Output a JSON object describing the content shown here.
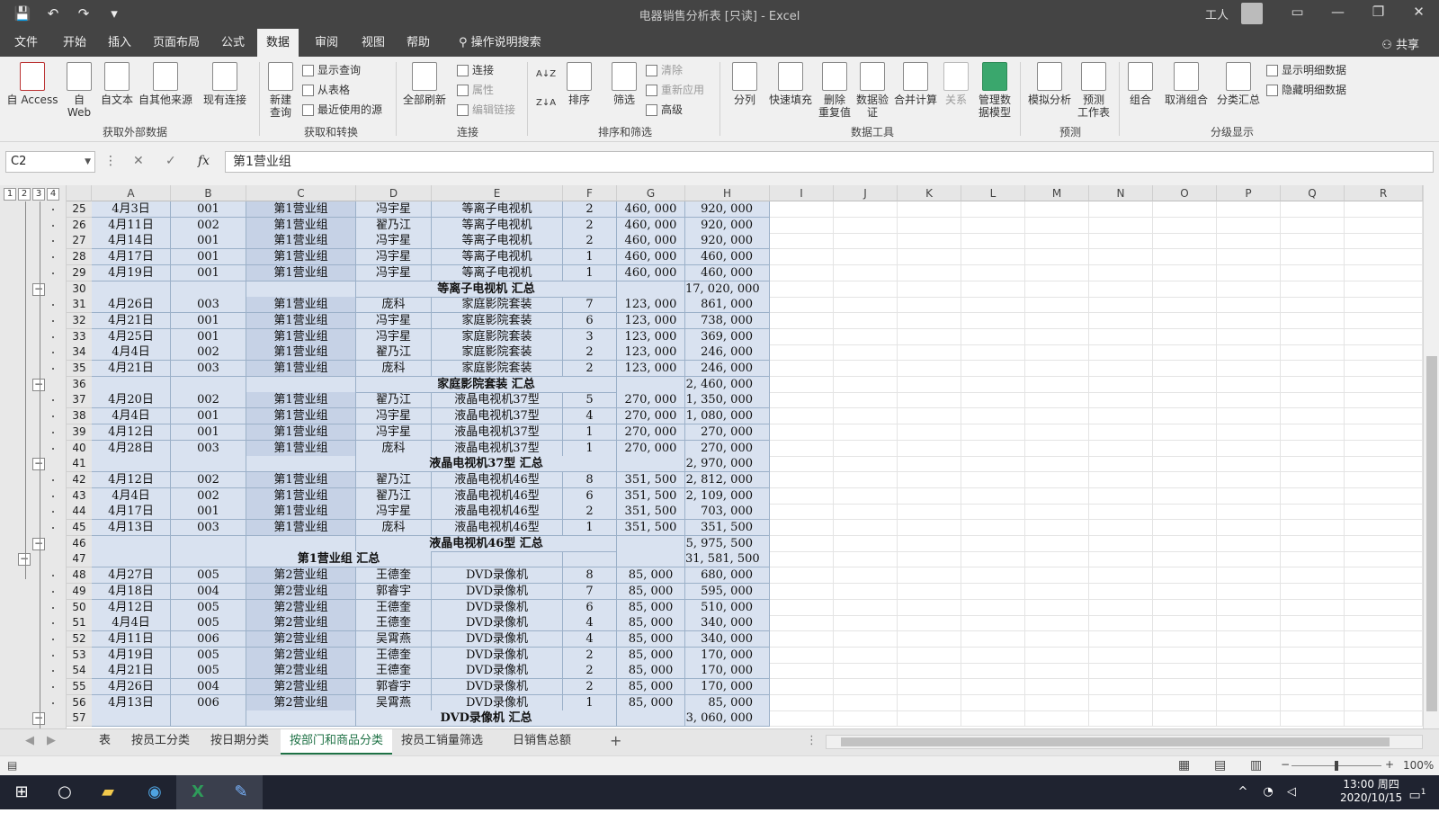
{
  "titlebar": {
    "title": "电器销售分析表  [只读]  -  Excel",
    "user": "工人",
    "qat_save": "💾",
    "qat_undo": "↶",
    "qat_redo": "↷",
    "qat_more": "▾",
    "win_ribbon": "▭",
    "win_min": "—",
    "win_max": "❐",
    "win_close": "✕"
  },
  "menu": {
    "tabs": [
      "文件",
      "开始",
      "插入",
      "页面布局",
      "公式",
      "数据",
      "审阅",
      "视图",
      "帮助",
      "操作说明搜索"
    ],
    "active": "数据",
    "share": "共享"
  },
  "ribbon": {
    "groups": [
      "获取外部数据",
      "获取和转换",
      "连接",
      "排序和筛选",
      "数据工具",
      "预测",
      "分级显示"
    ],
    "ext": [
      "自 Access",
      "自\nWeb",
      "自文本",
      "自其他来源",
      "现有连接"
    ],
    "gt_big": "新建\n查询",
    "gt_small": [
      "显示查询",
      "从表格",
      "最近使用的源"
    ],
    "conn_big": "全部刷新",
    "conn_small": [
      "连接",
      "属性",
      "编辑链接"
    ],
    "sort_small_az": "A↓Z",
    "sort_small_za": "Z↓A",
    "sort": "排序",
    "filter": "筛选",
    "filter_small": [
      "清除",
      "重新应用",
      "高级"
    ],
    "tools": [
      "分列",
      "快速填充",
      "删除\n重复值",
      "数据验\n证",
      "合并计算",
      "关系",
      "管理数\n据模型"
    ],
    "forecast": [
      "模拟分析",
      "预测\n工作表"
    ],
    "outline": [
      "组合",
      "取消组合",
      "分类汇总"
    ],
    "outline_small": [
      "显示明细数据",
      "隐藏明细数据"
    ]
  },
  "formula": {
    "namebox": "C2",
    "value": "第1营业组",
    "cancel_glyph": "✕",
    "enter_glyph": "✓",
    "fx_glyph": "fx"
  },
  "grid": {
    "levels": [
      "1",
      "2",
      "3",
      "4"
    ],
    "columns": [
      "A",
      "B",
      "C",
      "D",
      "E",
      "F",
      "G",
      "H",
      "I",
      "J",
      "K",
      "L",
      "M",
      "N",
      "O",
      "P",
      "Q",
      "R"
    ],
    "rows": [
      {
        "n": "25",
        "a": "4月3日",
        "b": "001",
        "c": "第1营业组",
        "d": "冯宇星",
        "e": "等离子电视机",
        "f": "2",
        "g": "460, 000",
        "h": "920, 000"
      },
      {
        "n": "26",
        "a": "4月11日",
        "b": "002",
        "c": "第1营业组",
        "d": "翟乃江",
        "e": "等离子电视机",
        "f": "2",
        "g": "460, 000",
        "h": "920, 000"
      },
      {
        "n": "27",
        "a": "4月14日",
        "b": "001",
        "c": "第1营业组",
        "d": "冯宇星",
        "e": "等离子电视机",
        "f": "2",
        "g": "460, 000",
        "h": "920, 000"
      },
      {
        "n": "28",
        "a": "4月17日",
        "b": "001",
        "c": "第1营业组",
        "d": "冯宇星",
        "e": "等离子电视机",
        "f": "1",
        "g": "460, 000",
        "h": "460, 000"
      },
      {
        "n": "29",
        "a": "4月19日",
        "b": "001",
        "c": "第1营业组",
        "d": "冯宇星",
        "e": "等离子电视机",
        "f": "1",
        "g": "460, 000",
        "h": "460, 000"
      },
      {
        "n": "30",
        "sub": "等离子电视机  汇总",
        "h": "17, 020, 000"
      },
      {
        "n": "31",
        "a": "4月26日",
        "b": "003",
        "c": "第1营业组",
        "d": "庞科",
        "e": "家庭影院套装",
        "f": "7",
        "g": "123, 000",
        "h": "861, 000"
      },
      {
        "n": "32",
        "a": "4月21日",
        "b": "001",
        "c": "第1营业组",
        "d": "冯宇星",
        "e": "家庭影院套装",
        "f": "6",
        "g": "123, 000",
        "h": "738, 000"
      },
      {
        "n": "33",
        "a": "4月25日",
        "b": "001",
        "c": "第1营业组",
        "d": "冯宇星",
        "e": "家庭影院套装",
        "f": "3",
        "g": "123, 000",
        "h": "369, 000"
      },
      {
        "n": "34",
        "a": "4月4日",
        "b": "002",
        "c": "第1营业组",
        "d": "翟乃江",
        "e": "家庭影院套装",
        "f": "2",
        "g": "123, 000",
        "h": "246, 000"
      },
      {
        "n": "35",
        "a": "4月21日",
        "b": "003",
        "c": "第1营业组",
        "d": "庞科",
        "e": "家庭影院套装",
        "f": "2",
        "g": "123, 000",
        "h": "246, 000"
      },
      {
        "n": "36",
        "sub": "家庭影院套装  汇总",
        "h": "2, 460, 000"
      },
      {
        "n": "37",
        "a": "4月20日",
        "b": "002",
        "c": "第1营业组",
        "d": "翟乃江",
        "e": "液晶电视机37型",
        "f": "5",
        "g": "270, 000",
        "h": "1, 350, 000"
      },
      {
        "n": "38",
        "a": "4月4日",
        "b": "001",
        "c": "第1营业组",
        "d": "冯宇星",
        "e": "液晶电视机37型",
        "f": "4",
        "g": "270, 000",
        "h": "1, 080, 000"
      },
      {
        "n": "39",
        "a": "4月12日",
        "b": "001",
        "c": "第1营业组",
        "d": "冯宇星",
        "e": "液晶电视机37型",
        "f": "1",
        "g": "270, 000",
        "h": "270, 000"
      },
      {
        "n": "40",
        "a": "4月28日",
        "b": "003",
        "c": "第1营业组",
        "d": "庞科",
        "e": "液晶电视机37型",
        "f": "1",
        "g": "270, 000",
        "h": "270, 000"
      },
      {
        "n": "41",
        "sub": "液晶电视机37型  汇总",
        "h": "2, 970, 000"
      },
      {
        "n": "42",
        "a": "4月12日",
        "b": "002",
        "c": "第1营业组",
        "d": "翟乃江",
        "e": "液晶电视机46型",
        "f": "8",
        "g": "351, 500",
        "h": "2, 812, 000"
      },
      {
        "n": "43",
        "a": "4月4日",
        "b": "002",
        "c": "第1营业组",
        "d": "翟乃江",
        "e": "液晶电视机46型",
        "f": "6",
        "g": "351, 500",
        "h": "2, 109, 000"
      },
      {
        "n": "44",
        "a": "4月17日",
        "b": "001",
        "c": "第1营业组",
        "d": "冯宇星",
        "e": "液晶电视机46型",
        "f": "2",
        "g": "351, 500",
        "h": "703, 000"
      },
      {
        "n": "45",
        "a": "4月13日",
        "b": "003",
        "c": "第1营业组",
        "d": "庞科",
        "e": "液晶电视机46型",
        "f": "1",
        "g": "351, 500",
        "h": "351, 500"
      },
      {
        "n": "46",
        "sub": "液晶电视机46型  汇总",
        "h": "5, 975, 500"
      },
      {
        "n": "47",
        "grp": "第1营业组  汇总",
        "h": "31, 581, 500"
      },
      {
        "n": "48",
        "a": "4月27日",
        "b": "005",
        "c": "第2营业组",
        "d": "王德奎",
        "e": "DVD录像机",
        "f": "8",
        "g": "85, 000",
        "h": "680, 000"
      },
      {
        "n": "49",
        "a": "4月18日",
        "b": "004",
        "c": "第2营业组",
        "d": "郭睿宇",
        "e": "DVD录像机",
        "f": "7",
        "g": "85, 000",
        "h": "595, 000"
      },
      {
        "n": "50",
        "a": "4月12日",
        "b": "005",
        "c": "第2营业组",
        "d": "王德奎",
        "e": "DVD录像机",
        "f": "6",
        "g": "85, 000",
        "h": "510, 000"
      },
      {
        "n": "51",
        "a": "4月4日",
        "b": "005",
        "c": "第2营业组",
        "d": "王德奎",
        "e": "DVD录像机",
        "f": "4",
        "g": "85, 000",
        "h": "340, 000"
      },
      {
        "n": "52",
        "a": "4月11日",
        "b": "006",
        "c": "第2营业组",
        "d": "吴霄燕",
        "e": "DVD录像机",
        "f": "4",
        "g": "85, 000",
        "h": "340, 000"
      },
      {
        "n": "53",
        "a": "4月19日",
        "b": "005",
        "c": "第2营业组",
        "d": "王德奎",
        "e": "DVD录像机",
        "f": "2",
        "g": "85, 000",
        "h": "170, 000"
      },
      {
        "n": "54",
        "a": "4月21日",
        "b": "005",
        "c": "第2营业组",
        "d": "王德奎",
        "e": "DVD录像机",
        "f": "2",
        "g": "85, 000",
        "h": "170, 000"
      },
      {
        "n": "55",
        "a": "4月26日",
        "b": "004",
        "c": "第2营业组",
        "d": "郭睿宇",
        "e": "DVD录像机",
        "f": "2",
        "g": "85, 000",
        "h": "170, 000"
      },
      {
        "n": "56",
        "a": "4月13日",
        "b": "006",
        "c": "第2营业组",
        "d": "吴霄燕",
        "e": "DVD录像机",
        "f": "1",
        "g": "85, 000",
        "h": "85, 000"
      },
      {
        "n": "57",
        "sub": "DVD录像机  汇总",
        "h": "3, 060, 000"
      }
    ]
  },
  "sheets": {
    "tabs": [
      "表",
      "按员工分类",
      "按日期分类",
      "按部门和商品分类",
      "按员工销量筛选",
      "日销售总额"
    ],
    "active": "按部门和商品分类",
    "add": "+",
    "nav_prev": "◀",
    "nav_next": "▶"
  },
  "status": {
    "zoom": "100%",
    "zoom_minus": "−",
    "zoom_plus": "+",
    "view_normal": "▦",
    "view_layout": "▤",
    "view_break": "▥"
  },
  "taskbar": {
    "time": "13:00 周四",
    "date": "2020/10/15",
    "start": "⊞",
    "search": "○",
    "notif_count": "1"
  }
}
